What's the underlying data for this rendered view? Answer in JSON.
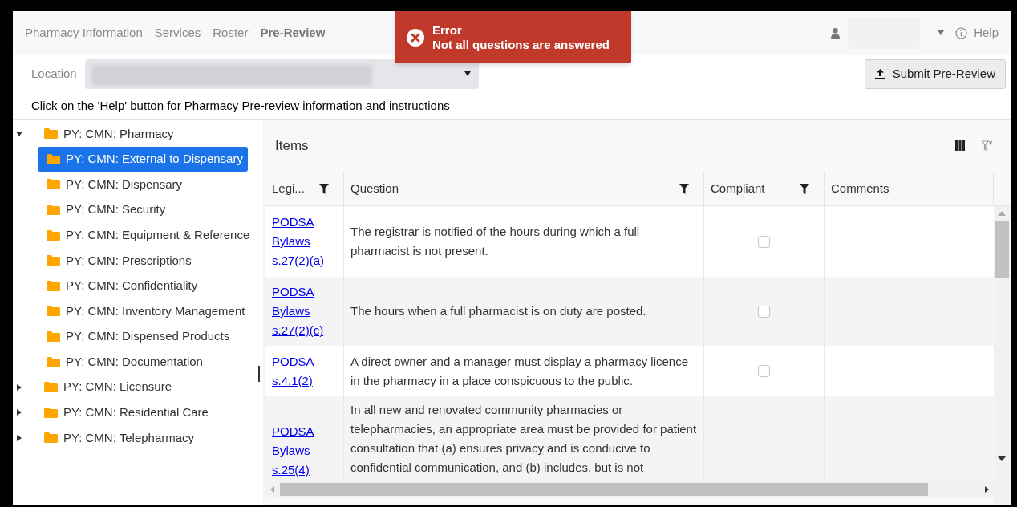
{
  "nav": {
    "tabs": [
      {
        "label": "Pharmacy Information",
        "selected": false
      },
      {
        "label": "Services",
        "selected": false
      },
      {
        "label": "Roster",
        "selected": false
      },
      {
        "label": "Pre-Review",
        "selected": true
      }
    ],
    "help": "Help"
  },
  "toast": {
    "title": "Error",
    "message": "Not all questions are answered"
  },
  "location": {
    "label": "Location"
  },
  "submit_button": "Submit Pre-Review",
  "instructions": "Click on the 'Help' button for Pharmacy Pre-review information and instructions",
  "tree": [
    {
      "label": "PY: CMN: Pharmacy",
      "expanded": true,
      "selected": false,
      "children": [
        {
          "label": "PY: CMN: External to Dispensary",
          "selected": true
        },
        {
          "label": "PY: CMN: Dispensary",
          "selected": false
        },
        {
          "label": "PY: CMN: Security",
          "selected": false
        },
        {
          "label": "PY: CMN: Equipment & Reference",
          "selected": false
        },
        {
          "label": "PY: CMN: Prescriptions",
          "selected": false
        },
        {
          "label": "PY: CMN: Confidentiality",
          "selected": false
        },
        {
          "label": "PY: CMN: Inventory Management",
          "selected": false
        },
        {
          "label": "PY: CMN: Dispensed Products",
          "selected": false
        },
        {
          "label": "PY: CMN: Documentation",
          "selected": false
        }
      ]
    },
    {
      "label": "PY: CMN: Licensure",
      "expanded": false,
      "selected": false
    },
    {
      "label": "PY: CMN: Residential Care",
      "expanded": false,
      "selected": false
    },
    {
      "label": "PY: CMN: Telepharmacy",
      "expanded": false,
      "selected": false
    }
  ],
  "items": {
    "title": "Items",
    "columns": [
      {
        "label": "Legi...",
        "filter": true
      },
      {
        "label": "Question",
        "filter": true
      },
      {
        "label": "Compliant",
        "filter": true
      },
      {
        "label": "Comments",
        "filter": false
      }
    ],
    "rows": [
      {
        "legislation": "PODSA Bylaws s.27(2)(a)",
        "question": "The registrar is notified of the hours during which a full pharmacist is not present.",
        "compliant": false
      },
      {
        "legislation": "PODSA Bylaws s.27(2)(c)",
        "question": "The hours when a full pharmacist is on duty are posted.",
        "compliant": false
      },
      {
        "legislation": "PODSA s.4.1(2)",
        "question": "A direct owner and a manager must display a pharmacy licence in the pharmacy in a place conspicuous to the public.",
        "compliant": false
      },
      {
        "legislation": "PODSA Bylaws s.25(4)",
        "question": "In all new and renovated community pharmacies or telepharmacies, an appropriate area must be provided for patient consultation that (a) ensures privacy and is conducive to confidential communication, and (b) includes, but is not"
      }
    ]
  }
}
